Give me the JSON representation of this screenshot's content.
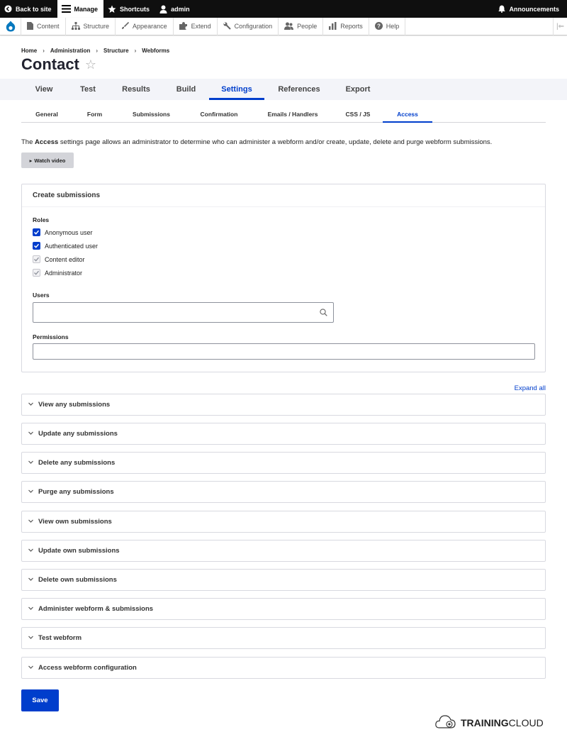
{
  "toolbar": {
    "back_to_site": "Back to site",
    "manage": "Manage",
    "shortcuts": "Shortcuts",
    "user": "admin",
    "announcements": "Announcements"
  },
  "tray": {
    "items": [
      "Content",
      "Structure",
      "Appearance",
      "Extend",
      "Configuration",
      "People",
      "Reports",
      "Help"
    ]
  },
  "breadcrumb": [
    "Home",
    "Administration",
    "Structure",
    "Webforms"
  ],
  "page_title": "Contact",
  "primary_tabs": [
    "View",
    "Test",
    "Results",
    "Build",
    "Settings",
    "References",
    "Export"
  ],
  "primary_active": "Settings",
  "secondary_tabs": [
    "General",
    "Form",
    "Submissions",
    "Confirmation",
    "Emails / Handlers",
    "CSS / JS",
    "Access"
  ],
  "secondary_active": "Access",
  "intro": {
    "prefix": "The ",
    "bold": "Access",
    "suffix": " settings page allows an administrator to determine who can administer a webform and/or create, update, delete and purge webform submissions."
  },
  "watch_video": "Watch video",
  "create_submissions": {
    "title": "Create submissions",
    "roles_label": "Roles",
    "roles": [
      {
        "label": "Anonymous user",
        "state": "checked"
      },
      {
        "label": "Authenticated user",
        "state": "checked"
      },
      {
        "label": "Content editor",
        "state": "disabled-checked"
      },
      {
        "label": "Administrator",
        "state": "disabled-checked"
      }
    ],
    "users_label": "Users",
    "users_value": "",
    "permissions_label": "Permissions",
    "permissions_value": ""
  },
  "expand_all": "Expand all",
  "sections": [
    "View any submissions",
    "Update any submissions",
    "Delete any submissions",
    "Purge any submissions",
    "View own submissions",
    "Update own submissions",
    "Delete own submissions",
    "Administer webform & submissions",
    "Test webform",
    "Access webform configuration"
  ],
  "save": "Save",
  "brand": {
    "bold": "TRAINING",
    "rest": "CLOUD"
  },
  "colors": {
    "accent": "#003ecc",
    "toolbar": "#0f0f0f",
    "tabs_bg": "#f3f4f9"
  }
}
